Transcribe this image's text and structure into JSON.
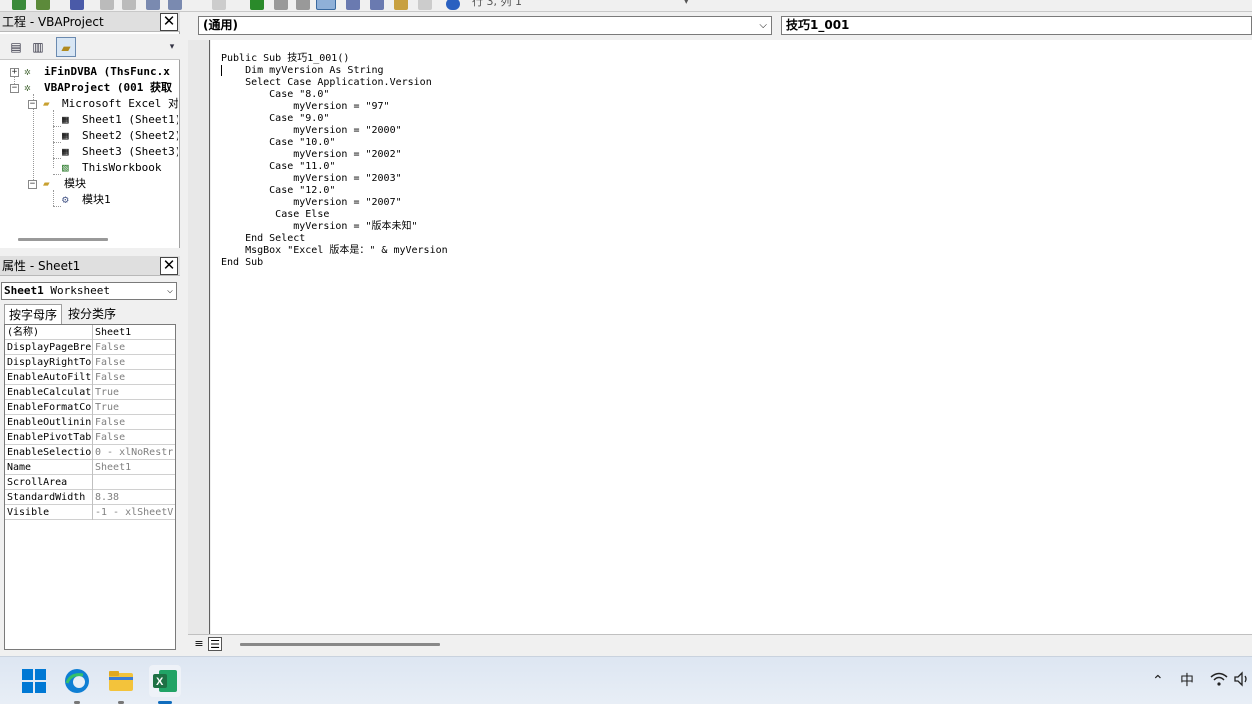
{
  "toolbar": {
    "status": "行 3, 列 1"
  },
  "project": {
    "title": "工程 - VBAProject",
    "tree": [
      {
        "label": "iFinDVBA (ThsFunc.x",
        "level": 0,
        "expanded": false,
        "bold": true
      },
      {
        "label": "VBAProject (001 获取",
        "level": 0,
        "expanded": true,
        "bold": true
      },
      {
        "label": "Microsoft Excel 对象",
        "level": 1,
        "expanded": true
      },
      {
        "label": "Sheet1 (Sheet1)",
        "level": 2
      },
      {
        "label": "Sheet2 (Sheet2)",
        "level": 2
      },
      {
        "label": "Sheet3 (Sheet3)",
        "level": 2
      },
      {
        "label": "ThisWorkbook",
        "level": 2
      },
      {
        "label": "模块",
        "level": 1,
        "expanded": true
      },
      {
        "label": "模块1",
        "level": 2
      }
    ]
  },
  "props": {
    "title": "属性 - Sheet1",
    "object": {
      "name": "Sheet1",
      "type": "Worksheet"
    },
    "tabs": [
      "按字母序",
      "按分类序"
    ],
    "rows": [
      {
        "k": "(名称)",
        "v": "Sheet1"
      },
      {
        "k": "DisplayPageBre",
        "v": "False"
      },
      {
        "k": "DisplayRightTo",
        "v": "False"
      },
      {
        "k": "EnableAutoFilt",
        "v": "False"
      },
      {
        "k": "EnableCalculat",
        "v": "True"
      },
      {
        "k": "EnableFormatCo",
        "v": "True"
      },
      {
        "k": "EnableOutlinin",
        "v": "False"
      },
      {
        "k": "EnablePivotTab",
        "v": "False"
      },
      {
        "k": "EnableSelectio",
        "v": "0 - xlNoRestr"
      },
      {
        "k": "Name",
        "v": "Sheet1"
      },
      {
        "k": "ScrollArea",
        "v": ""
      },
      {
        "k": "StandardWidth",
        "v": "8.38"
      },
      {
        "k": "Visible",
        "v": "-1 - xlSheetV"
      }
    ]
  },
  "code": {
    "object_combo": "(通用)",
    "proc_combo": "技巧1_001",
    "text": "Public Sub 技巧1_001()\n    Dim myVersion As String\n    Select Case Application.Version\n        Case \"8.0\"\n            myVersion = \"97\"\n        Case \"9.0\"\n            myVersion = \"2000\"\n        Case \"10.0\"\n            myVersion = \"2002\"\n        Case \"11.0\"\n            myVersion = \"2003\"\n        Case \"12.0\"\n            myVersion = \"2007\"\n         Case Else\n            myVersion = \"版本未知\"\n    End Select\n    MsgBox \"Excel 版本是：\" & myVersion\nEnd Sub"
  },
  "taskbar": {
    "ime": "中"
  },
  "colors": {
    "excel": "#1e7145",
    "edge": "#0f7fd4",
    "folder": "#f3c33b",
    "windows": "#0078d4"
  }
}
